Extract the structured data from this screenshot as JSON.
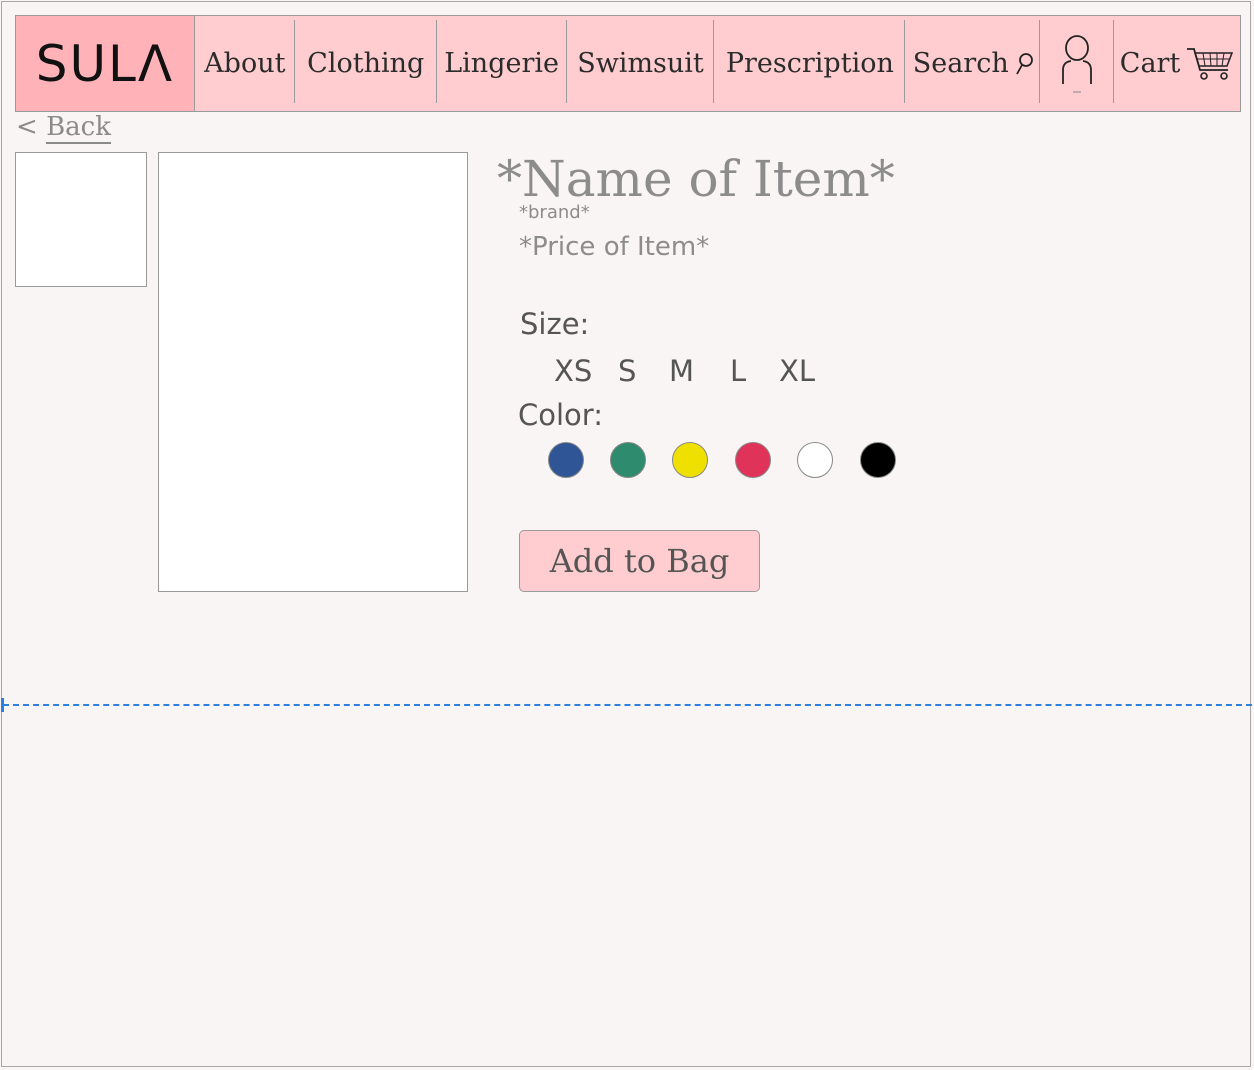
{
  "brand_logo": "SULΛ",
  "nav": {
    "about": "About",
    "clothing": "Clothing",
    "lingerie": "Lingerie",
    "swimsuit": "Swimsuit",
    "prescription": "Prescription",
    "search": "Search",
    "cart": "Cart"
  },
  "back_link": {
    "arrow": "<",
    "label": "Back"
  },
  "product": {
    "name": "*Name of Item*",
    "brand": "*brand*",
    "price": "*Price of Item*"
  },
  "size": {
    "label": "Size:",
    "options": [
      "XS",
      "S",
      "M",
      "L",
      "XL"
    ]
  },
  "color": {
    "label": "Color:",
    "swatches": [
      "#2f5597",
      "#2e8b6e",
      "#f0e000",
      "#e0335a",
      "#ffffff",
      "#000000"
    ]
  },
  "add_to_bag": "Add to Bag",
  "icons": [
    "search-icon",
    "user-icon",
    "cart-icon"
  ]
}
